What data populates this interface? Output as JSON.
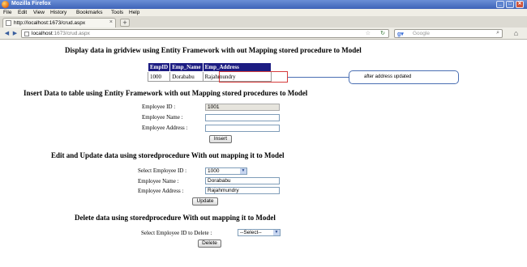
{
  "window": {
    "title": "Mozilla Firefox"
  },
  "menu": [
    "File",
    "Edit",
    "View",
    "History",
    "Bookmarks",
    "Tools",
    "Help"
  ],
  "tab": {
    "label": "http://localhost:1673/crud.aspx"
  },
  "address": {
    "host": "localhost",
    "path": ":1673/crud.aspx"
  },
  "search": {
    "placeholder": "Google"
  },
  "sections": {
    "display_title": "Display data in gridview using Entity Framework with out Mapping stored procedure to Model",
    "insert_title": "Insert Data to table using Entity Framework with out Mapping stored procedures to Model",
    "edit_title": "Edit and Update data using storedprocedure With out mapping it to Model",
    "delete_title": "Delete data using storedprocedure With out mapping it to Model"
  },
  "grid": {
    "headers": [
      "EmpID",
      "Emp_Name",
      "Emp_Address"
    ],
    "rows": [
      [
        "1000",
        "Dorababu",
        "Rajahmundry"
      ]
    ]
  },
  "annotation": "after address updated",
  "insert": {
    "id_label": "Employee ID :",
    "id_value": "1001",
    "name_label": "Employee Name :",
    "name_value": "",
    "address_label": "Employee Address :",
    "address_value": "",
    "button": "Insert"
  },
  "edit": {
    "select_label": "Select Employee ID :",
    "select_value": "1000",
    "name_label": "Employee Name :",
    "name_value": "Dorababu",
    "address_label": "Employee Address :",
    "address_value": "Rajahmundry",
    "button": "Update"
  },
  "delete": {
    "select_label": "Select Employee ID to Delete :",
    "select_value": "--Select--",
    "button": "Delete"
  }
}
